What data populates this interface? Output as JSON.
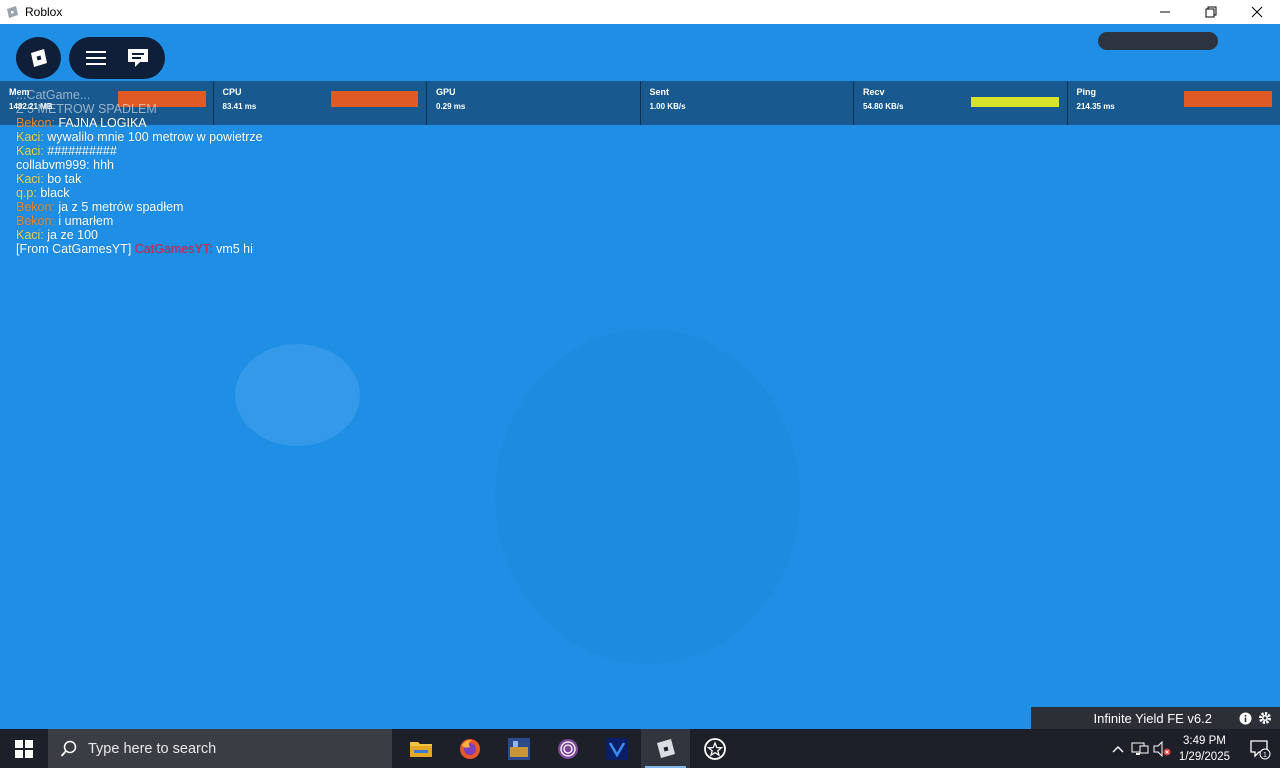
{
  "window": {
    "title": "Roblox",
    "controls": [
      "minimize",
      "restore",
      "close"
    ]
  },
  "stats": [
    {
      "label": "Mem",
      "value": "1482.21 MB",
      "bar_color": "#e05a25"
    },
    {
      "label": "CPU",
      "value": "83.41 ms",
      "bar_color": "#e05a25"
    },
    {
      "label": "GPU",
      "value": "0.29 ms",
      "bar_color": ""
    },
    {
      "label": "Sent",
      "value": "1.00 KB/s",
      "bar_color": ""
    },
    {
      "label": "Recv",
      "value": "54.80 KB/s",
      "bar_color": "#d6e22b"
    },
    {
      "label": "Ping",
      "value": "214.35 ms",
      "bar_color": "#e05a25"
    }
  ],
  "chat": {
    "lines": [
      {
        "speaker": "",
        "text": "...CatGame...",
        "color": "white",
        "faded": true
      },
      {
        "speaker": "",
        "text": "Z 5 METROW SPADLEM",
        "color": "white",
        "faded": true
      },
      {
        "speaker": "Bekon:",
        "text": "FAJNA LOGIKA",
        "color": "orange"
      },
      {
        "speaker": "Kaci:",
        "text": "wywalilo mnie 100 metrow w powietrze",
        "color": "yellow"
      },
      {
        "speaker": "Kaci:",
        "text": "##########",
        "color": "yellow"
      },
      {
        "speaker": "",
        "text": "collabvm999: hhh",
        "color": "white"
      },
      {
        "speaker": "Kaci:",
        "text": "bo tak",
        "color": "yellow"
      },
      {
        "speaker": "q.p:",
        "text": "black",
        "color": "yellow"
      },
      {
        "speaker": "Bekon:",
        "text": "ja z 5 metrów spadłem",
        "color": "orange"
      },
      {
        "speaker": "Bekon:",
        "text": "i umarłem",
        "color": "orange"
      },
      {
        "speaker": "Kaci:",
        "text": "ja ze 100",
        "color": "yellow"
      },
      {
        "speaker": "[From CatGamesYT]",
        "text": "vm5 hi",
        "color": "white",
        "speaker2": "CatGamesYT:"
      }
    ]
  },
  "infinite_yield": {
    "label": "Infinite Yield FE v6.2"
  },
  "taskbar": {
    "search_placeholder": "Type here to search",
    "apps": [
      "file-explorer",
      "firefox",
      "game-app",
      "tor-browser",
      "vm-app",
      "roblox",
      "star-app"
    ],
    "time": "3:49 PM",
    "date": "1/29/2025",
    "notification_count": "1"
  }
}
